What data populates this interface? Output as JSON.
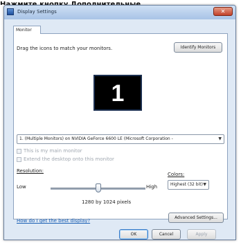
{
  "caption": "Нажмите кнопку Дополнительные",
  "window": {
    "title": "Display Settings",
    "close_glyph": "✕"
  },
  "tab": {
    "label": "Monitor"
  },
  "instructions": "Drag the icons to match your monitors.",
  "identify_button": "Identify Monitors",
  "monitor_number": "1",
  "monitor_select": "1. (Multiple Monitors) on NVIDIA GeForce 6600 LE (Microsoft Corporation - ",
  "checkbox_main": "This is my main monitor",
  "checkbox_extend": "Extend the desktop onto this monitor",
  "resolution": {
    "label": "Resolution:",
    "low": "Low",
    "high": "High",
    "value": "1280 by 1024 pixels",
    "level": 0.5
  },
  "colors": {
    "label": "Colors:",
    "value": "Highest (32 bit)"
  },
  "help_link": "How do I get the best display?",
  "advanced_button": "Advanced Settings...",
  "footer": {
    "ok": "OK",
    "cancel": "Cancel",
    "apply": "Apply"
  }
}
